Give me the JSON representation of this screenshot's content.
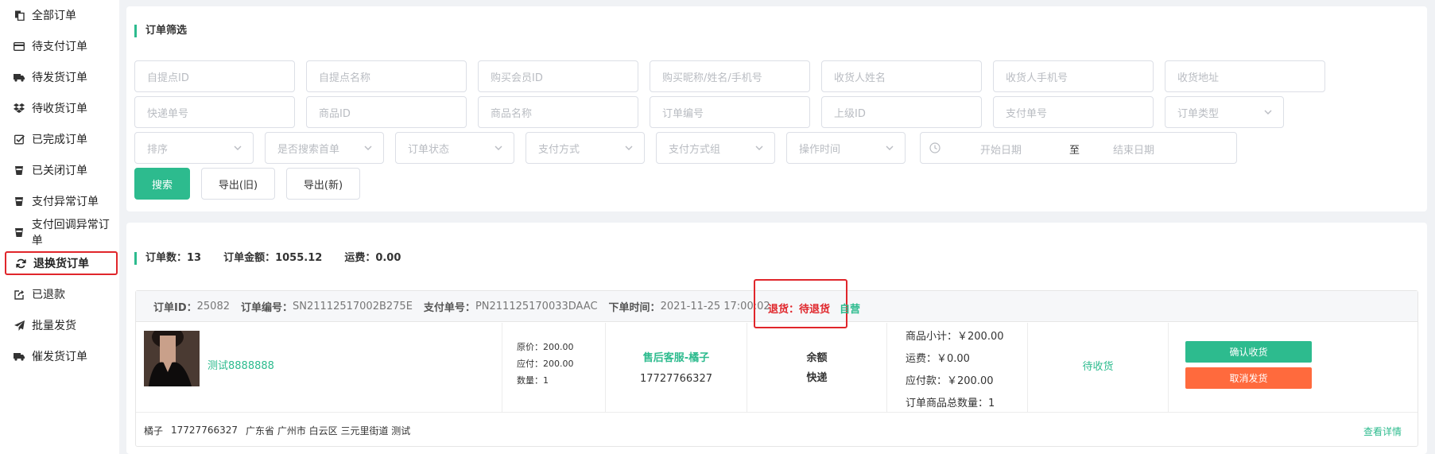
{
  "sidebar": {
    "items": [
      {
        "label": "全部订单",
        "icon": "copy-icon"
      },
      {
        "label": "待支付订单",
        "icon": "credit-card-icon"
      },
      {
        "label": "待发货订单",
        "icon": "truck-icon"
      },
      {
        "label": "待收货订单",
        "icon": "dropbox-icon"
      },
      {
        "label": "已完成订单",
        "icon": "check-square-icon"
      },
      {
        "label": "已关闭订单",
        "icon": "cup-icon"
      },
      {
        "label": "支付异常订单",
        "icon": "cup-icon"
      },
      {
        "label": "支付回调异常订单",
        "icon": "cup-icon"
      },
      {
        "label": "退换货订单",
        "icon": "refresh-icon"
      },
      {
        "label": "已退款",
        "icon": "share-icon"
      },
      {
        "label": "批量发货",
        "icon": "send-icon"
      },
      {
        "label": "催发货订单",
        "icon": "truck-icon"
      }
    ],
    "active_index": 8
  },
  "filter": {
    "title": "订单筛选",
    "fields": {
      "pickup_point_id": "自提点ID",
      "pickup_point_name": "自提点名称",
      "member_id": "购买会员ID",
      "buyer_info": "购买昵称/姓名/手机号",
      "receiver_name": "收货人姓名",
      "receiver_phone": "收货人手机号",
      "receiver_address": "收货地址",
      "express_no": "快递单号",
      "goods_id": "商品ID",
      "goods_name": "商品名称",
      "order_no": "订单编号",
      "parent_id": "上级ID",
      "pay_no": "支付单号",
      "order_type": "订单类型",
      "sort": "排序",
      "first_order": "是否搜索首单",
      "order_status": "订单状态",
      "pay_method": "支付方式",
      "pay_method_group": "支付方式组",
      "op_time": "操作时间"
    },
    "date_range": {
      "start": "开始日期",
      "separator": "至",
      "end": "结束日期"
    },
    "buttons": {
      "search": "搜索",
      "export_old": "导出(旧)",
      "export_new": "导出(新)"
    }
  },
  "stats": {
    "order_count": "订单数：13",
    "order_amount": "订单金额：1055.12",
    "freight": "运费：0.00"
  },
  "order": {
    "id_label": "订单ID：",
    "id": "25082",
    "no_label": "订单编号：",
    "no": "SN21112517002B275E",
    "pay_no_label": "支付单号：",
    "pay_no": "PN211125170033DAAC",
    "time_label": "下单时间：",
    "time": "2021-11-25 17:00:02",
    "status": "退货：待退货",
    "tag": "自营",
    "product_name": "测试8888888",
    "original_price": "原价：200.00",
    "payable": "应付：200.00",
    "quantity": "数量：1",
    "service_name": "售后客服-橘子",
    "service_phone": "17727766327",
    "pay_method": "余额",
    "delivery": "快递",
    "subtotal": "商品小计：￥200.00",
    "freight": "运费：￥0.00",
    "payable_total": "应付款：￥200.00",
    "total_qty": "订单商品总数量：1",
    "state": "待收货",
    "confirm_btn": "确认收货",
    "cancel_btn": "取消发货",
    "receiver": "橘子",
    "receiver_phone": "17727766327",
    "address": "广东省 广州市 白云区 三元里街道 测试",
    "detail_link": "查看详情"
  },
  "colors": {
    "accent": "#2dbb8e",
    "danger": "#e0262b",
    "cancel": "#ff6a3d"
  }
}
